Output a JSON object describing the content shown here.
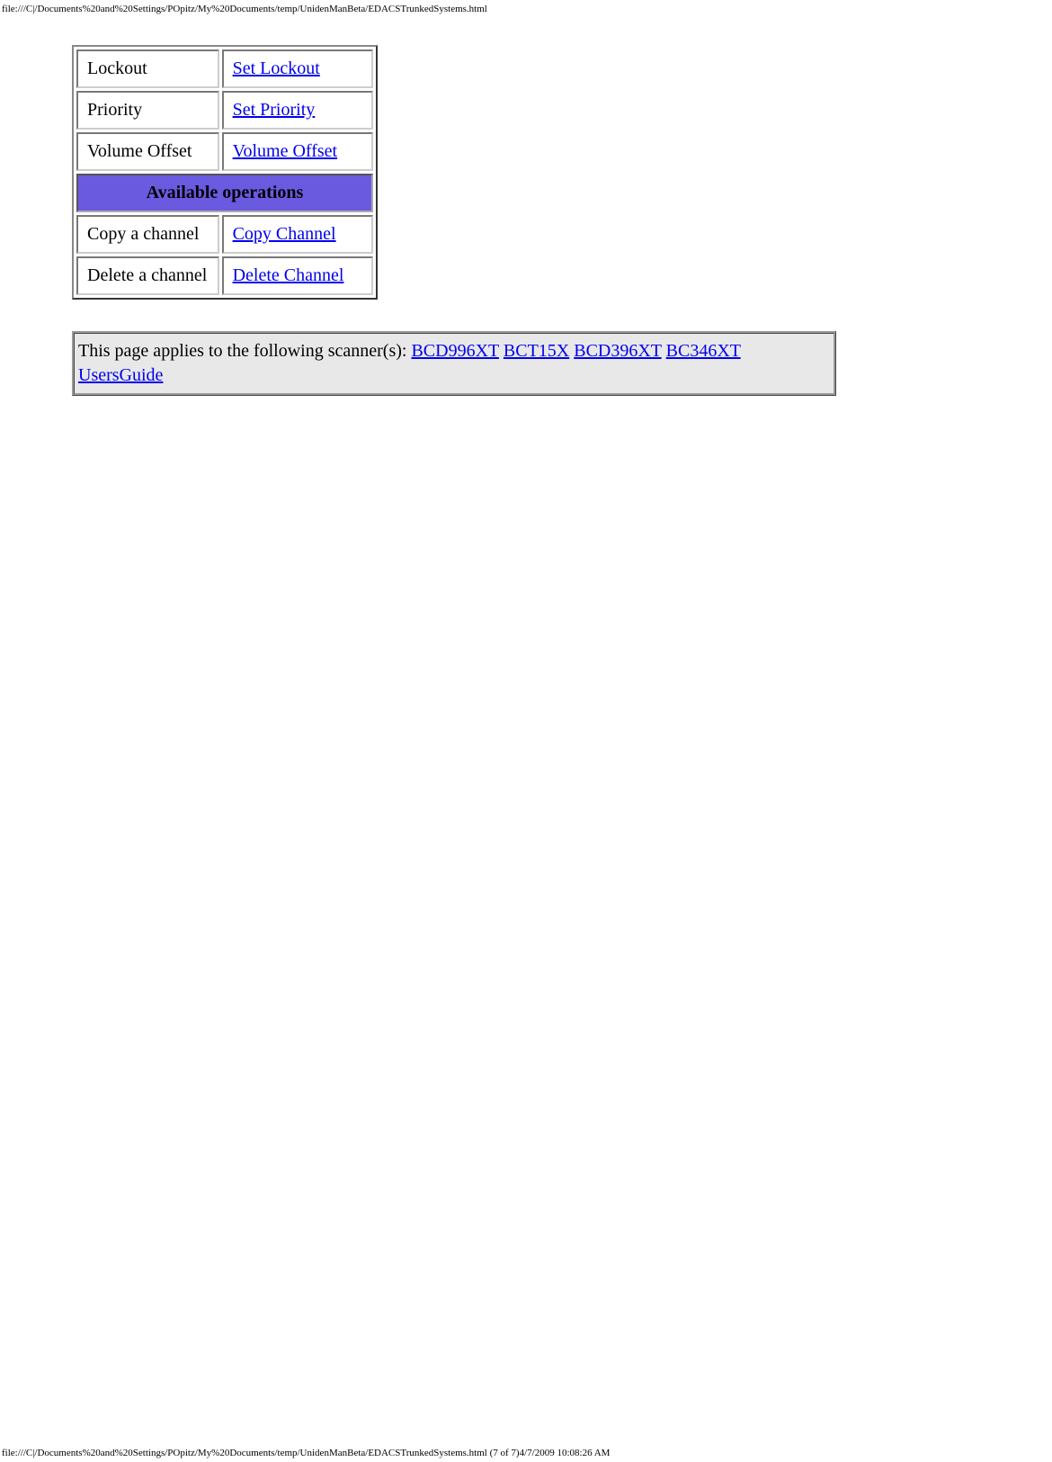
{
  "header_path": "file:///C|/Documents%20and%20Settings/POpitz/My%20Documents/temp/UnidenManBeta/EDACSTrunkedSystems.html",
  "table": {
    "rows_top": [
      {
        "label": "Lockout",
        "link": "Set Lockout"
      },
      {
        "label": "Priority",
        "link": "Set Priority"
      },
      {
        "label": "Volume Offset",
        "link": "Volume Offset"
      }
    ],
    "section_header": "Available operations",
    "rows_bottom": [
      {
        "label": "Copy a channel",
        "link": "Copy Channel"
      },
      {
        "label": "Delete a channel",
        "link": "Delete Channel"
      }
    ]
  },
  "applies": {
    "prefix": "This page applies to the following scanner(s): ",
    "links": [
      "BCD996XT",
      "BCT15X",
      "BCD396XT",
      "BC346XT",
      "UsersGuide"
    ]
  },
  "footer_path": "file:///C|/Documents%20and%20Settings/POpitz/My%20Documents/temp/UnidenManBeta/EDACSTrunkedSystems.html (7 of 7)4/7/2009 10:08:26 AM"
}
